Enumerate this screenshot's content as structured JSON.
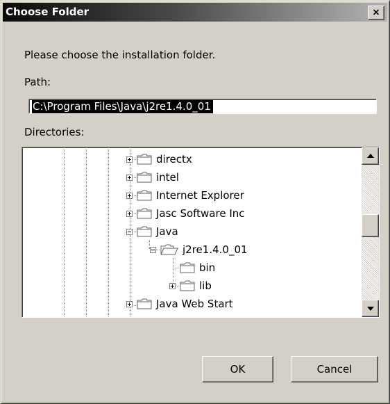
{
  "window": {
    "title": "Choose Folder",
    "close_label": "×"
  },
  "prompt": "Please choose the installation folder.",
  "path": {
    "label": "Path:",
    "value": "C:\\Program Files\\Java\\j2re1.4.0_01"
  },
  "directories": {
    "label": "Directories:",
    "items": [
      {
        "label": "directx",
        "state": "collapsed",
        "level": 1,
        "icon": "folder-icon"
      },
      {
        "label": "intel",
        "state": "collapsed",
        "level": 1,
        "icon": "folder-icon"
      },
      {
        "label": "Internet Explorer",
        "state": "collapsed",
        "level": 1,
        "icon": "folder-icon"
      },
      {
        "label": "Jasc Software Inc",
        "state": "collapsed",
        "level": 1,
        "icon": "folder-icon"
      },
      {
        "label": "Java",
        "state": "expanded",
        "level": 1,
        "icon": "folder-icon"
      },
      {
        "label": "j2re1.4.0_01",
        "state": "expanded",
        "level": 2,
        "icon": "open-folder-icon",
        "selected": true
      },
      {
        "label": "bin",
        "state": "leaf",
        "level": 3,
        "icon": "folder-icon"
      },
      {
        "label": "lib",
        "state": "collapsed",
        "level": 3,
        "icon": "folder-icon"
      },
      {
        "label": "Java Web Start",
        "state": "collapsed",
        "level": 1,
        "icon": "folder-icon"
      }
    ]
  },
  "buttons": {
    "ok": "OK",
    "cancel": "Cancel"
  }
}
